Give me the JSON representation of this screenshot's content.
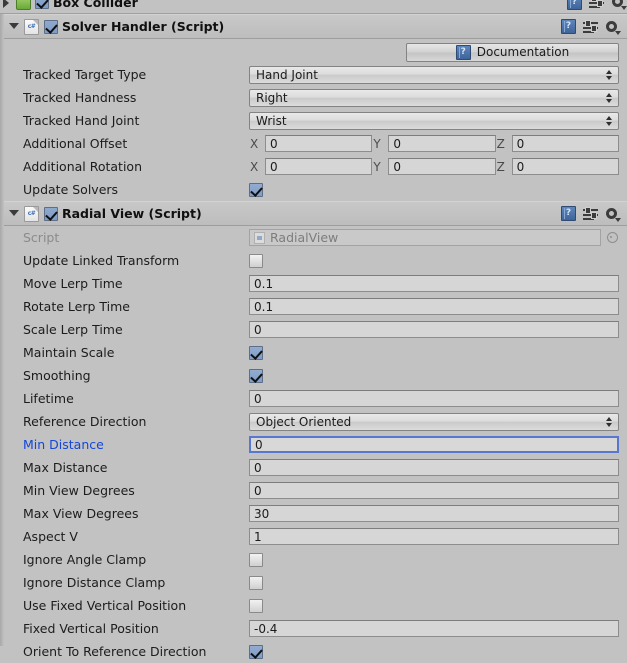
{
  "clipped_component": {
    "title": "Box Collider",
    "enabled": true,
    "icons": [
      "help-icon",
      "preset-icon",
      "settings-icon"
    ]
  },
  "components": [
    {
      "id": "solver-handler",
      "title": "Solver Handler (Script)",
      "enabled": true,
      "expanded": true,
      "icons": [
        "help-icon",
        "preset-icon",
        "settings-icon"
      ],
      "documentation_button": "Documentation",
      "rows": [
        {
          "label": "Tracked Target Type",
          "type": "dropdown",
          "value": "Hand Joint"
        },
        {
          "label": "Tracked Handness",
          "type": "dropdown",
          "value": "Right"
        },
        {
          "label": "Tracked Hand Joint",
          "type": "dropdown",
          "value": "Wrist"
        },
        {
          "label": "Additional Offset",
          "type": "vector3",
          "axes": [
            "X",
            "Y",
            "Z"
          ],
          "values": [
            "0",
            "0",
            "0"
          ]
        },
        {
          "label": "Additional Rotation",
          "type": "vector3",
          "axes": [
            "X",
            "Y",
            "Z"
          ],
          "values": [
            "0",
            "0",
            "0"
          ]
        },
        {
          "label": "Update Solvers",
          "type": "checkbox",
          "checked": true
        }
      ]
    },
    {
      "id": "radial-view",
      "title": "Radial View (Script)",
      "enabled": true,
      "expanded": true,
      "icons": [
        "help-icon",
        "preset-icon",
        "settings-icon"
      ],
      "rows": [
        {
          "label": "Script",
          "type": "object",
          "value": "RadialView",
          "disabled": true
        },
        {
          "label": "Update Linked Transform",
          "type": "checkbox",
          "checked": false
        },
        {
          "label": "Move Lerp Time",
          "type": "text",
          "value": "0.1"
        },
        {
          "label": "Rotate Lerp Time",
          "type": "text",
          "value": "0.1"
        },
        {
          "label": "Scale Lerp Time",
          "type": "text",
          "value": "0"
        },
        {
          "label": "Maintain Scale",
          "type": "checkbox",
          "checked": true
        },
        {
          "label": "Smoothing",
          "type": "checkbox",
          "checked": true
        },
        {
          "label": "Lifetime",
          "type": "text",
          "value": "0"
        },
        {
          "label": "Reference Direction",
          "type": "dropdown",
          "value": "Object Oriented"
        },
        {
          "label": "Min Distance",
          "type": "text",
          "value": "0",
          "focused": true,
          "highlighted": true
        },
        {
          "label": "Max Distance",
          "type": "text",
          "value": "0"
        },
        {
          "label": "Min View Degrees",
          "type": "text",
          "value": "0"
        },
        {
          "label": "Max View Degrees",
          "type": "text",
          "value": "30"
        },
        {
          "label": "Aspect V",
          "type": "text",
          "value": "1"
        },
        {
          "label": "Ignore Angle Clamp",
          "type": "checkbox",
          "checked": false
        },
        {
          "label": "Ignore Distance Clamp",
          "type": "checkbox",
          "checked": false
        },
        {
          "label": "Use Fixed Vertical Position",
          "type": "checkbox",
          "checked": false
        },
        {
          "label": "Fixed Vertical Position",
          "type": "text",
          "value": "-0.4"
        },
        {
          "label": "Orient To Reference Direction",
          "type": "checkbox",
          "checked": true
        }
      ]
    }
  ],
  "icon_glyphs": {
    "help": "?",
    "cs": "c#"
  },
  "colors": {
    "background": "#c2c2c2",
    "header": "#c8c8c8",
    "field": "#d6d6d6",
    "accent_blue": "#1546d8",
    "focus_border": "#5a77cf",
    "checkbox_on": "#7f9dc7"
  }
}
